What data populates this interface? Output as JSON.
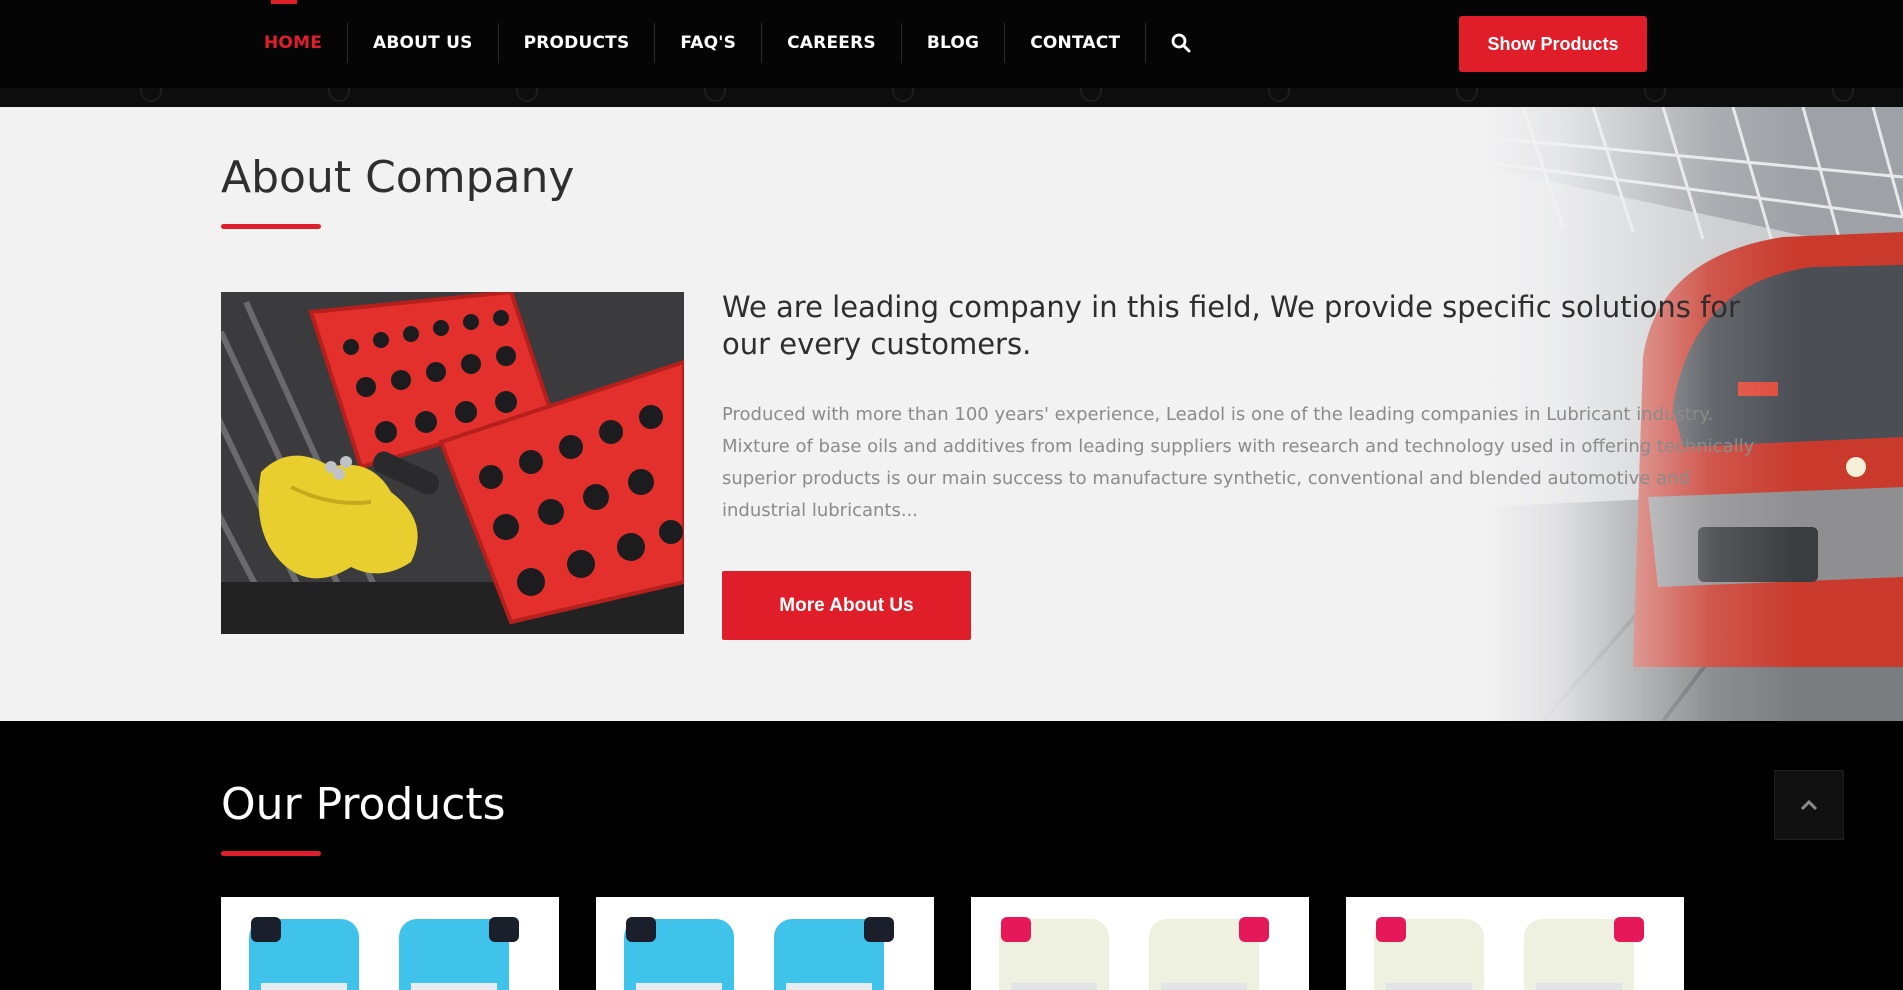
{
  "nav": {
    "items": [
      {
        "label": "HOME",
        "active": true
      },
      {
        "label": "ABOUT US",
        "active": false
      },
      {
        "label": "PRODUCTS",
        "active": false
      },
      {
        "label": "FAQ'S",
        "active": false
      },
      {
        "label": "CAREERS",
        "active": false
      },
      {
        "label": "BLOG",
        "active": false
      },
      {
        "label": "CONTACT",
        "active": false
      }
    ],
    "search_icon": "search-icon",
    "cta_label": "Show Products"
  },
  "about": {
    "title": "About Company",
    "lead_lines": [
      "We are leading company in this field, We provide specific solutions for",
      "our every customers."
    ],
    "body_lines": [
      "Produced with more than 100 years' experience, Leadol is one of the leading companies in Lubricant industry.",
      "Mixture of base oils and additives from leading suppliers with research and technology used in offering technically",
      "superior products is our main success to manufacture synthetic, conventional and blended automotive and",
      "industrial lubricants..."
    ],
    "button_label": "More About Us"
  },
  "products": {
    "title": "Our Products",
    "scroll_top_icon": "chevron-up-icon",
    "cards": [
      {
        "bottle_color": "#3fc3ea",
        "cap_color": "#1b1f2b"
      },
      {
        "bottle_color": "#3fc3ea",
        "cap_color": "#1b1f2b"
      },
      {
        "bottle_color": "#eef1df",
        "cap_color": "#e5185a"
      },
      {
        "bottle_color": "#eef1df",
        "cap_color": "#e5185a"
      }
    ]
  },
  "colors": {
    "accent": "#e01e2a",
    "nav_bg": "#050505",
    "about_bg": "#f2f2f3"
  }
}
